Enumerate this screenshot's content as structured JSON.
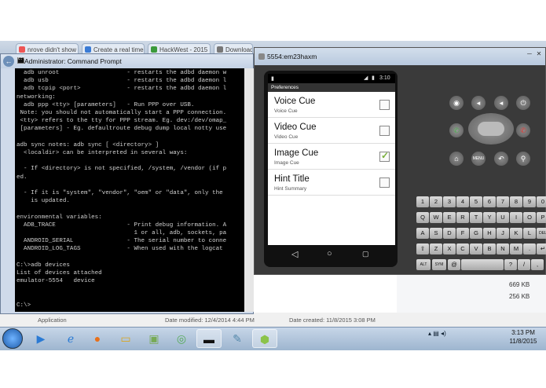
{
  "browser": {
    "tabs": [
      "nrove didn't show up in N",
      "Create a real time line graph in",
      "HackWest - 2015 HackerWest",
      "Download"
    ]
  },
  "cmd": {
    "title": "Administrator: Command Prompt",
    "lines": [
      "  adb unroot                   - restarts the adbd daemon w",
      "  adb usb                      - restarts the adbd daemon l",
      "  adb tcpip <port>             - restarts the adbd daemon l",
      "networking:",
      "  adb ppp <tty> [parameters]   - Run PPP over USB.",
      " Note: you should not automatically start a PPP connection.",
      " <tty> refers to the tty for PPP stream. Eg. dev:/dev/omap_",
      " [parameters] - Eg. defaultroute debug dump local notty use",
      "",
      "adb sync notes: adb sync [ <directory> ]",
      "  <localdir> can be interpreted in several ways:",
      "",
      "  - If <directory> is not specified, /system, /vendor (if p",
      "ed.",
      "",
      "  - If it is \"system\", \"vendor\", \"oem\" or \"data\", only the",
      "    is updated.",
      "",
      "environmental variables:",
      "  ADB_TRACE                    - Print debug information. A",
      "                                 1 or all, adb, sockets, pa",
      "  ANDROID_SERIAL               - The serial number to conne",
      "  ANDROID_LOG_TAGS             - When used with the logcat ",
      "",
      "C:\\>adb devices",
      "List of devices attached",
      "emulator-5554   device",
      "",
      "",
      "C:\\>"
    ]
  },
  "explorer": {
    "sizes": [
      "669 KB",
      "256 KB"
    ],
    "status": {
      "name": "Application",
      "modified": "Date modified: 12/4/2014 4:44 PM",
      "created": "Date created: 11/8/2015 3:08 PM"
    }
  },
  "emulator": {
    "title": "5554:em23haxm",
    "status_time": "3:10",
    "action_bar_title": "Preferences",
    "prefs": [
      {
        "title": "Voice Cue",
        "summary": "Voice Cue",
        "checked": false
      },
      {
        "title": "Video Cue",
        "summary": "Video Cue",
        "checked": false
      },
      {
        "title": "Image Cue",
        "summary": "Image Cue",
        "checked": true
      },
      {
        "title": "Hint Title",
        "summary": "Hint Summary",
        "checked": false
      }
    ],
    "menu_label": "MENU",
    "keyboard": {
      "row1": [
        "1",
        "2",
        "3",
        "4",
        "5",
        "6",
        "7",
        "8",
        "9",
        "0"
      ],
      "row2": [
        "Q",
        "W",
        "E",
        "R",
        "T",
        "Y",
        "U",
        "I",
        "O",
        "P"
      ],
      "row3": [
        "A",
        "S",
        "D",
        "F",
        "G",
        "H",
        "J",
        "K",
        "L",
        "DEL"
      ],
      "row4": [
        "⇧",
        "Z",
        "X",
        "C",
        "V",
        "B",
        "N",
        "M",
        ".",
        "↵"
      ],
      "row5": [
        "ALT",
        "SYM",
        "@",
        "",
        "?",
        "/",
        ","
      ]
    }
  },
  "taskbar": {
    "time": "3:13 PM",
    "date": "11/8/2015"
  }
}
